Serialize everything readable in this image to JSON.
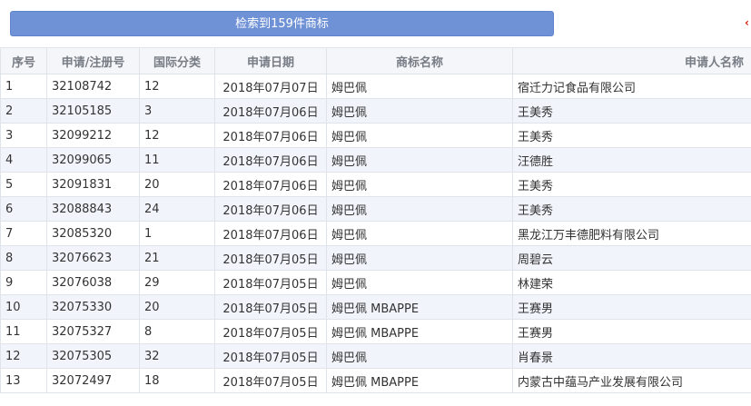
{
  "banner": {
    "text": "检索到159件商标"
  },
  "edge_mark": {
    "text": "‹"
  },
  "columns": {
    "seq": "序号",
    "reg_no": "申请/注册号",
    "class": "国际分类",
    "date": "申请日期",
    "name": "商标名称",
    "applicant": "申请人名称"
  },
  "rows": [
    {
      "seq": "1",
      "reg_no": "32108742",
      "class": "12",
      "date": "2018年07月07日",
      "name": "姆巴佩",
      "applicant": "宿迁力记食品有限公司"
    },
    {
      "seq": "2",
      "reg_no": "32105185",
      "class": "3",
      "date": "2018年07月06日",
      "name": "姆巴佩",
      "applicant": "王美秀"
    },
    {
      "seq": "3",
      "reg_no": "32099212",
      "class": "12",
      "date": "2018年07月06日",
      "name": "姆巴佩",
      "applicant": "王美秀"
    },
    {
      "seq": "4",
      "reg_no": "32099065",
      "class": "11",
      "date": "2018年07月06日",
      "name": "姆巴佩",
      "applicant": "汪德胜"
    },
    {
      "seq": "5",
      "reg_no": "32091831",
      "class": "20",
      "date": "2018年07月06日",
      "name": "姆巴佩",
      "applicant": "王美秀"
    },
    {
      "seq": "6",
      "reg_no": "32088843",
      "class": "24",
      "date": "2018年07月06日",
      "name": "姆巴佩",
      "applicant": "王美秀"
    },
    {
      "seq": "7",
      "reg_no": "32085320",
      "class": "1",
      "date": "2018年07月06日",
      "name": "姆巴佩",
      "applicant": "黑龙江万丰德肥料有限公司"
    },
    {
      "seq": "8",
      "reg_no": "32076623",
      "class": "21",
      "date": "2018年07月05日",
      "name": "姆巴佩",
      "applicant": "周碧云"
    },
    {
      "seq": "9",
      "reg_no": "32076038",
      "class": "29",
      "date": "2018年07月05日",
      "name": "姆巴佩",
      "applicant": "林建荣"
    },
    {
      "seq": "10",
      "reg_no": "32075330",
      "class": "20",
      "date": "2018年07月05日",
      "name": "姆巴佩 MBAPPE",
      "applicant": "王赛男"
    },
    {
      "seq": "11",
      "reg_no": "32075327",
      "class": "8",
      "date": "2018年07月05日",
      "name": "姆巴佩 MBAPPE",
      "applicant": "王赛男"
    },
    {
      "seq": "12",
      "reg_no": "32075305",
      "class": "32",
      "date": "2018年07月05日",
      "name": "姆巴佩",
      "applicant": "肖春景"
    },
    {
      "seq": "13",
      "reg_no": "32072497",
      "class": "18",
      "date": "2018年07月05日",
      "name": "姆巴佩 MBAPPE",
      "applicant": "内蒙古中蕴马产业发展有限公司"
    }
  ]
}
